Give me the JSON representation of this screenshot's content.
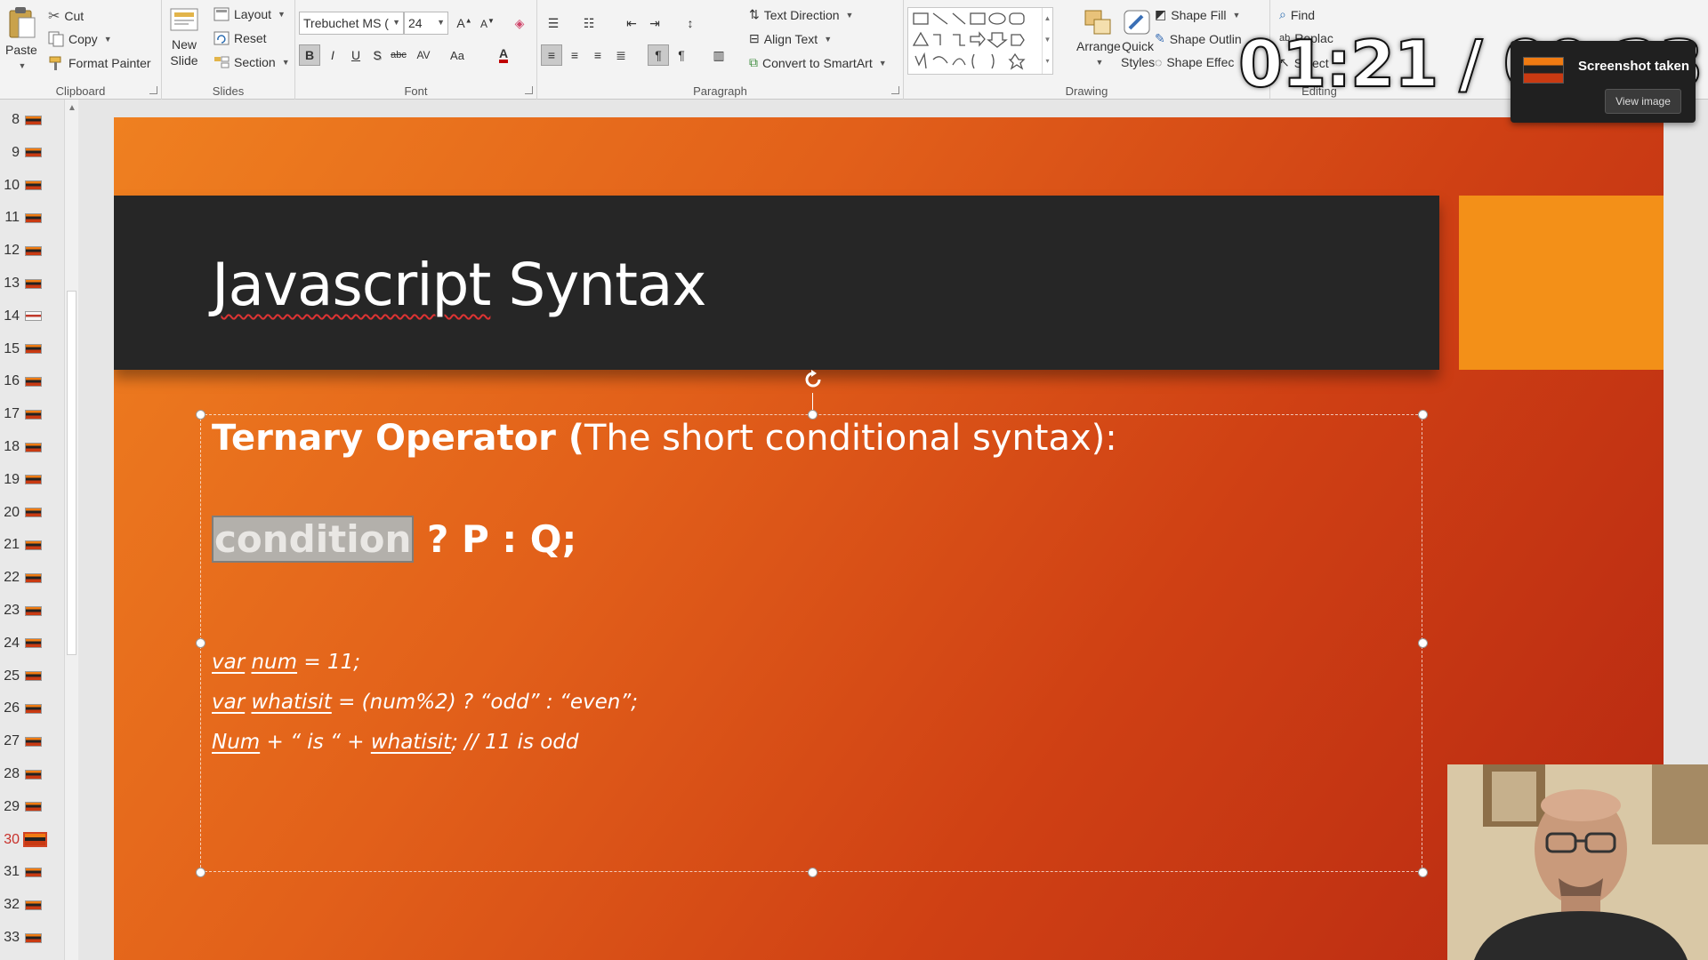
{
  "ribbon": {
    "clipboard": {
      "label": "Clipboard",
      "paste": "Paste",
      "cut": "Cut",
      "copy": "Copy",
      "format_painter": "Format Painter"
    },
    "slides": {
      "label": "Slides",
      "new_slide_line1": "New",
      "new_slide_line2": "Slide",
      "layout": "Layout",
      "reset": "Reset",
      "section": "Section"
    },
    "font": {
      "label": "Font",
      "family": "Trebuchet MS (",
      "size": "24"
    },
    "paragraph": {
      "label": "Paragraph",
      "text_direction": "Text Direction",
      "align_text": "Align Text",
      "convert_smartart": "Convert to SmartArt"
    },
    "drawing": {
      "label": "Drawing",
      "arrange": "Arrange",
      "quick_styles_line1": "Quick",
      "quick_styles_line2": "Styles",
      "shape_fill": "Shape Fill",
      "shape_outline": "Shape Outlin",
      "shape_effects": "Shape Effec"
    },
    "editing": {
      "label": "Editing",
      "find": "Find",
      "replace": "Replac",
      "select": "Select"
    }
  },
  "thumbnails": {
    "numbers": [
      "8",
      "9",
      "10",
      "11",
      "12",
      "13",
      "14",
      "15",
      "16",
      "17",
      "18",
      "19",
      "20",
      "21",
      "22",
      "23",
      "24",
      "25",
      "26",
      "27",
      "28",
      "29",
      "30",
      "31",
      "32",
      "33"
    ],
    "active": "30",
    "light": "14"
  },
  "slide": {
    "title_word1": "Javascript",
    "title_word2": "Syntax",
    "heading_bold": "Ternary Operator (",
    "heading_rest": "The short conditional syntax):",
    "syntax_condition": "condition",
    "syntax_rest": " ? P : Q;",
    "code_line1": {
      "kw": "var",
      "name": "num",
      "rest": " = 11;"
    },
    "code_line2": {
      "kw": "var",
      "name": "whatisit",
      "rest": " = (num%2) ? “odd” : “even”;"
    },
    "code_line3": {
      "name": "Num",
      "mid": " + “ is “ + ",
      "var": "whatisit",
      "rest": "; // 11 is odd"
    }
  },
  "overlay": {
    "timer": "01:21 / 09:23",
    "toast_title": "Screenshot taken",
    "toast_button": "View image"
  },
  "colors": {
    "slide_gradient_start": "#ef8020",
    "slide_gradient_end": "#b72812",
    "title_band": "#262626",
    "accent_box": "#f39018",
    "active_slide_number": "#c8302a"
  }
}
